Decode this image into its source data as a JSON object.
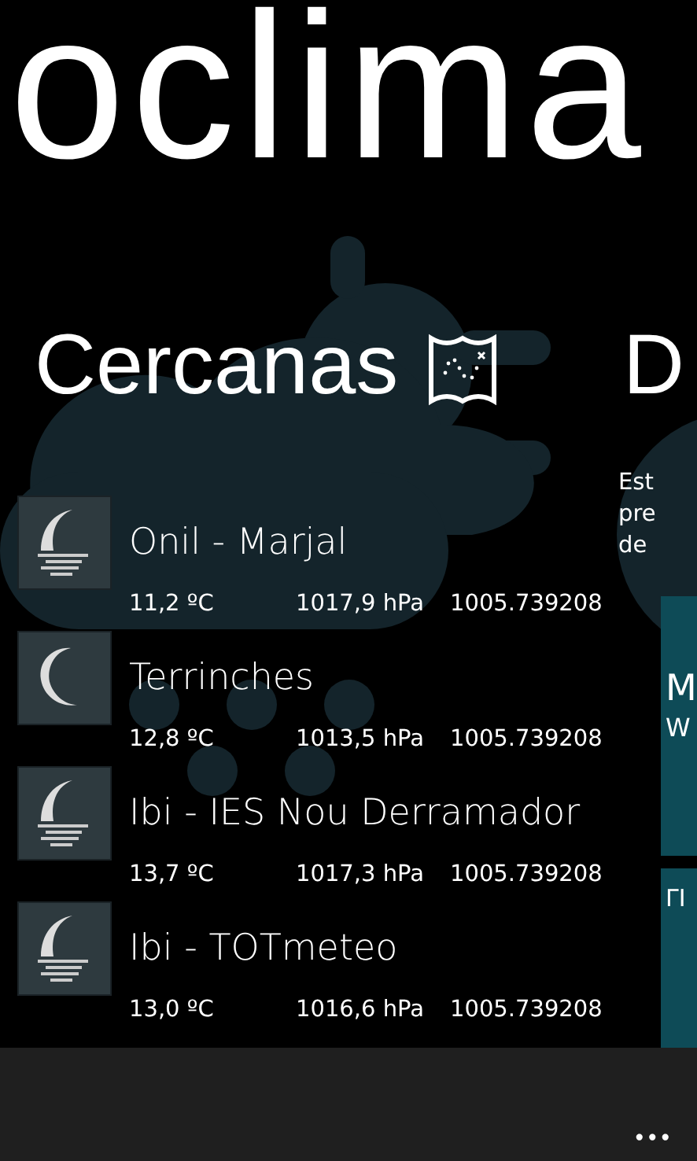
{
  "app_title": "oclima",
  "section": {
    "title": "Cercanas"
  },
  "stations": [
    {
      "name": "Onil - Marjal",
      "kind": "moon-fog",
      "temperature": "11,2 ºC",
      "pressure": "1017,9 hPa",
      "value": "1005.739208"
    },
    {
      "name": "Terrinches",
      "kind": "moon",
      "temperature": "12,8 ºC",
      "pressure": "1013,5 hPa",
      "value": "1005.739208"
    },
    {
      "name": "Ibi - IES Nou Derramador",
      "kind": "moon-fog",
      "temperature": "13,7 ºC",
      "pressure": "1017,3 hPa",
      "value": "1005.739208"
    },
    {
      "name": "Ibi - TOTmeteo",
      "kind": "moon-fog",
      "temperature": "13,0 ºC",
      "pressure": "1016,6 hPa",
      "value": "1005.739208"
    }
  ],
  "next_section": {
    "title": "D",
    "lines": [
      "Est",
      "pre",
      "de"
    ],
    "tiles": [
      {
        "title": "M",
        "subtitle": "W"
      },
      {
        "title": "ΓΙ"
      }
    ]
  },
  "app_bar": {
    "more": "•••"
  }
}
